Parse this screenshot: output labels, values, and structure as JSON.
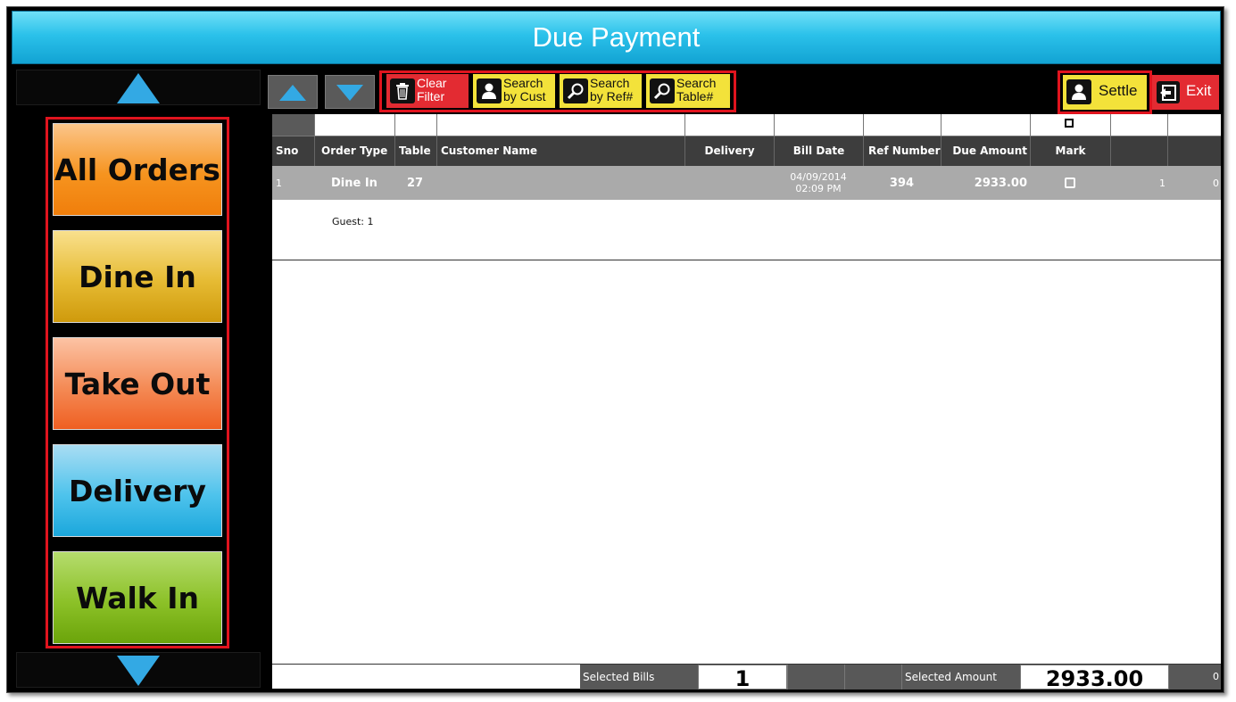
{
  "window": {
    "title": "Due Payment"
  },
  "categories": [
    {
      "label": "All Orders",
      "color": "#f6941f"
    },
    {
      "label": "Dine In",
      "color": "#dcae1c"
    },
    {
      "label": "Take Out",
      "color": "#f2763a"
    },
    {
      "label": "Delivery",
      "color": "#3fbde9"
    },
    {
      "label": "Walk In",
      "color": "#80bd1a"
    }
  ],
  "toolbar": {
    "clear_filter": [
      "Clear",
      "Filter"
    ],
    "search_cust": [
      "Search",
      "by Cust"
    ],
    "search_ref": [
      "Search",
      "by Ref#"
    ],
    "search_table": [
      "Search",
      "Table#"
    ],
    "settle": "Settle",
    "exit": "Exit"
  },
  "table": {
    "columns": [
      "Sno",
      "Order Type",
      "Table",
      "Customer Name",
      "Delivery",
      "Bill Date",
      "Ref Number",
      "Due Amount",
      "Mark"
    ],
    "rows": [
      {
        "sno": "1",
        "order_type": "Dine In",
        "table": "27",
        "customer_name": "",
        "delivery": "",
        "bill_date": "04/09/2014",
        "bill_time": "02:09 PM",
        "ref_number": "394",
        "due_amount": "2933.00",
        "marked": false,
        "extra1": "1",
        "extra2": "0",
        "guest": "Guest: 1"
      }
    ]
  },
  "footer": {
    "selected_bills_label": "Selected Bills",
    "selected_bills": "1",
    "selected_amount_label": "Selected Amount",
    "selected_amount": "2933.00",
    "trailing": "0"
  },
  "colors": {
    "highlight": "#e0141e",
    "title_bar": "#2bc1ea",
    "nav_arrow": "#33a9e4"
  }
}
